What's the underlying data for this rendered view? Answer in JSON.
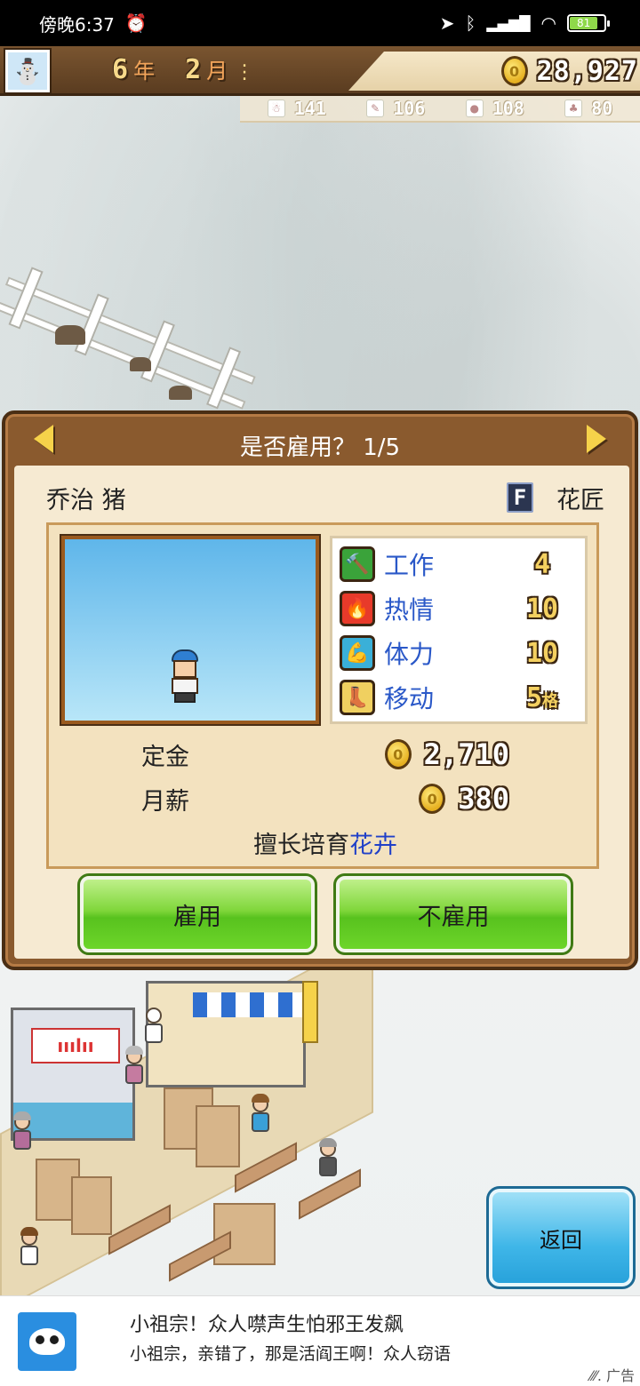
{
  "status_bar": {
    "time": "傍晚6:37",
    "battery": "81"
  },
  "header": {
    "year_num": "6",
    "year_unit": "年",
    "month_num": "2",
    "month_unit": "月",
    "money": "28,927",
    "resources": [
      {
        "icon": "snowman-icon",
        "value": "141"
      },
      {
        "icon": "pencil-icon",
        "value": "106"
      },
      {
        "icon": "strawberry-icon",
        "value": "108"
      },
      {
        "icon": "tree-icon",
        "value": "80"
      }
    ]
  },
  "dialog": {
    "title": "是否雇用？ 1/5",
    "name": "乔治 猪",
    "rank": "F",
    "job": "花匠",
    "stats": [
      {
        "icon": "hammer-icon",
        "label": "工作",
        "value": "4",
        "color": "#3aa33a"
      },
      {
        "icon": "flame-icon",
        "label": "热情",
        "value": "10",
        "color": "#e83a2a"
      },
      {
        "icon": "muscle-icon",
        "label": "体力",
        "value": "10",
        "color": "#3ab0d8"
      },
      {
        "icon": "boot-icon",
        "label": "移动",
        "value": "5",
        "unit": "格",
        "color": "#f0d060"
      }
    ],
    "deposit_label": "定金",
    "deposit_value": "2,710",
    "salary_label": "月薪",
    "salary_value": "380",
    "skill_prefix": "擅长培育",
    "skill_highlight": "花卉",
    "hire_label": "雇用",
    "decline_label": "不雇用"
  },
  "return_label": "返回",
  "ad": {
    "line1": "小祖宗！众人噤声生怕邪王发飙",
    "line2": "小祖宗，亲错了，那是活阎王啊！众人窃语",
    "tag": "广告"
  }
}
